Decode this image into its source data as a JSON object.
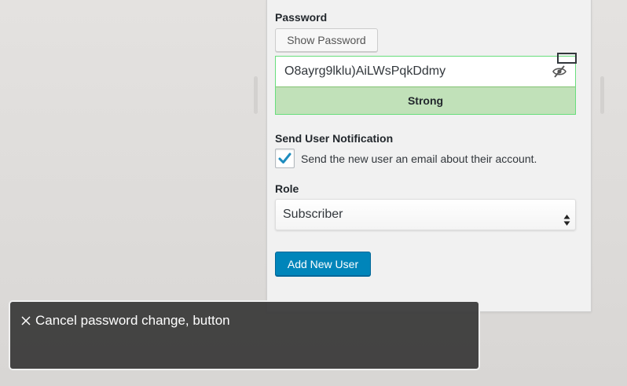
{
  "form": {
    "password_label": "Password",
    "show_password_button": "Show Password",
    "password_value": "O8ayrg9lklu)AiLWsPqkDdmy",
    "strength_text": "Strong",
    "notification_label": "Send User Notification",
    "notification_checkbox_label": "Send the new user an email about their account.",
    "notification_checked": true,
    "role_label": "Role",
    "role_selected": "Subscriber",
    "submit_button": "Add New User"
  },
  "voiceover": {
    "caption": "Cancel password change, button"
  },
  "colors": {
    "primary": "#0085ba",
    "strong_bg": "#c1e1b9",
    "strong_border": "#68de7c",
    "caption_bg": "#383838"
  },
  "icons": {
    "password_visibility": "eye-slash-icon",
    "checkbox": "checkmark-icon",
    "select_arrows": "sort-arrows-icon",
    "caption_close": "close-icon"
  }
}
